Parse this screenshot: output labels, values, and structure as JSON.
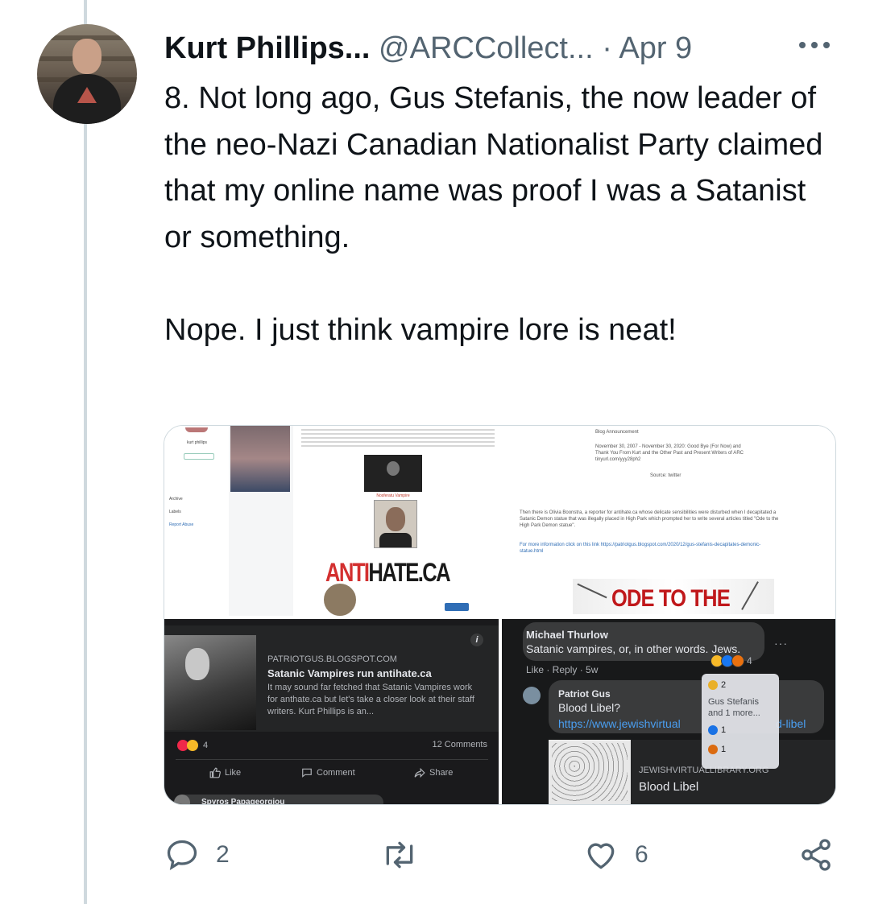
{
  "author": {
    "display_name": "Kurt Phillips...",
    "handle": "@ARCCollect...",
    "separator": "·",
    "date": "Apr 9"
  },
  "tweet": {
    "text": "8. Not long ago, Gus Stefanis, the now leader of the neo-Nazi Canadian Nationalist Party claimed that my online name was proof I was a Satanist or something.\n\nNope. I just think vampire lore is neat!"
  },
  "media": {
    "q1": {
      "logo_red": "ANTI",
      "logo_dark": "HATE.CA"
    },
    "q2": {
      "blog_announcement": "Blog Announcement",
      "line1": "November 30, 2007 - November 30, 2020: Good Bye (For Now) and",
      "line2": "Thank You From Kurt and the Other Past and Present Writers of ARC",
      "line3": "tinyurl.com/yyy28ph2",
      "source": "Source: twitter",
      "para1": "Then there is Olivia Boonstra, a reporter for antihate.ca whose delicate sensibilities were disturbed when I decapitated a",
      "para2": "Satanic Demon statue that was illegally placed in High Park which prompted her to write several articles titled \"Ode to the",
      "para3": "High Park Demon statue\".",
      "more_info": "For more information click on this link https://patriotgus.blogspot.com/2020/12/gus-stefanis-decapitates-demonic-",
      "more_info2": "statue.html",
      "banner": "ODE TO THE"
    },
    "q3": {
      "domain": "PATRIOTGUS.BLOGSPOT.COM",
      "title": "Satanic Vampires run antihate.ca",
      "description": "It may sound far fetched that Satanic Vampires work for anthate.ca but let's take a closer look at their staff writers. Kurt Phillips is an...",
      "reaction_count": "4",
      "comments": "12 Comments",
      "like": "Like",
      "comment": "Comment",
      "share": "Share",
      "commenter": "Spyros Papageorgiou"
    },
    "q4": {
      "comment1_name": "Michael Thurlow",
      "comment1_text": "Satanic vampires, or, in other words. Jews.",
      "comment1_meta": "Like · Reply · 5w",
      "comment1_reacts": "4",
      "comment2_name": "Patriot Gus",
      "comment2_text": "Blood Libel?",
      "comment2_link": "https://www.jewishvirtual",
      "comment2_link_end": "d-libel",
      "card_domain": "JEWISHVIRTUALLIBRARY.ORG",
      "card_title": "Blood Libel",
      "tip_count1": "2",
      "tip_names": "Gus Stefanis",
      "tip_more": "and 1 more...",
      "tip_count2": "1",
      "tip_count3": "1"
    }
  },
  "actions": {
    "reply_count": "2",
    "retweet_count": "",
    "like_count": "6"
  },
  "colors": {
    "text": "#0f1419",
    "muted": "#536471",
    "thread_line": "#cfd9de",
    "antihate_red": "#d32f2f",
    "fb_dark": "#18191a"
  }
}
